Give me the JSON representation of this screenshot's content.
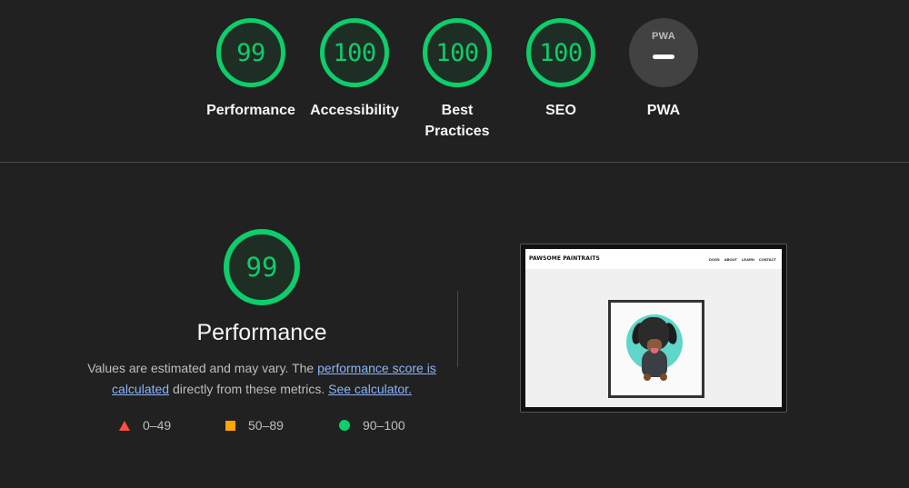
{
  "gauges": [
    {
      "score": "99",
      "label": "Performance"
    },
    {
      "score": "100",
      "label": "Accessibility"
    },
    {
      "score": "100",
      "label": "Best Practices"
    },
    {
      "score": "100",
      "label": "SEO"
    },
    {
      "score": "",
      "label": "PWA",
      "badge_text": "PWA"
    }
  ],
  "performance": {
    "score": "99",
    "title": "Performance",
    "desc_prefix": "Values are estimated and may vary. The ",
    "score_link": "performance score is calculated",
    "desc_middle": " directly from these metrics. ",
    "calculator_link": "See calculator."
  },
  "legend": [
    {
      "range": "0–49",
      "shape": "triangle",
      "color": "#ff4e42"
    },
    {
      "range": "50–89",
      "shape": "square",
      "color": "#ffa400"
    },
    {
      "range": "90–100",
      "shape": "circle",
      "color": "#0cce6b"
    }
  ],
  "thumbnail": {
    "site_logo": "PAWSOME PAINTRAITS",
    "menu": [
      "DOGS",
      "ABOUT",
      "LEARN",
      "CONTACT"
    ]
  },
  "colors": {
    "pass": "#0cce6b",
    "average": "#ffa400",
    "fail": "#ff4e42",
    "background": "#212121",
    "link": "#8ab4f8"
  }
}
